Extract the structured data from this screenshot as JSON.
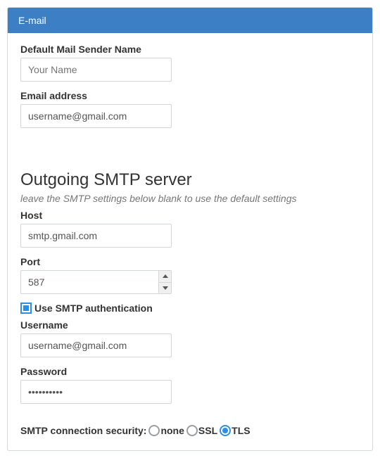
{
  "panel": {
    "title": "E-mail"
  },
  "sender": {
    "label": "Default Mail Sender Name",
    "placeholder": "Your Name",
    "value": ""
  },
  "email": {
    "label": "Email address",
    "value": "username@gmail.com"
  },
  "smtp": {
    "heading": "Outgoing SMTP server",
    "hint": "leave the SMTP settings below blank to use the default settings",
    "host": {
      "label": "Host",
      "value": "smtp.gmail.com"
    },
    "port": {
      "label": "Port",
      "value": "587"
    },
    "auth": {
      "label": "Use SMTP authentication",
      "checked": true
    },
    "username": {
      "label": "Username",
      "value": "username@gmail.com"
    },
    "password": {
      "label": "Password",
      "value": "••••••••••"
    },
    "security": {
      "label": "SMTP connection security:",
      "options": [
        "none",
        "SSL",
        "TLS"
      ],
      "selected": "TLS"
    }
  }
}
